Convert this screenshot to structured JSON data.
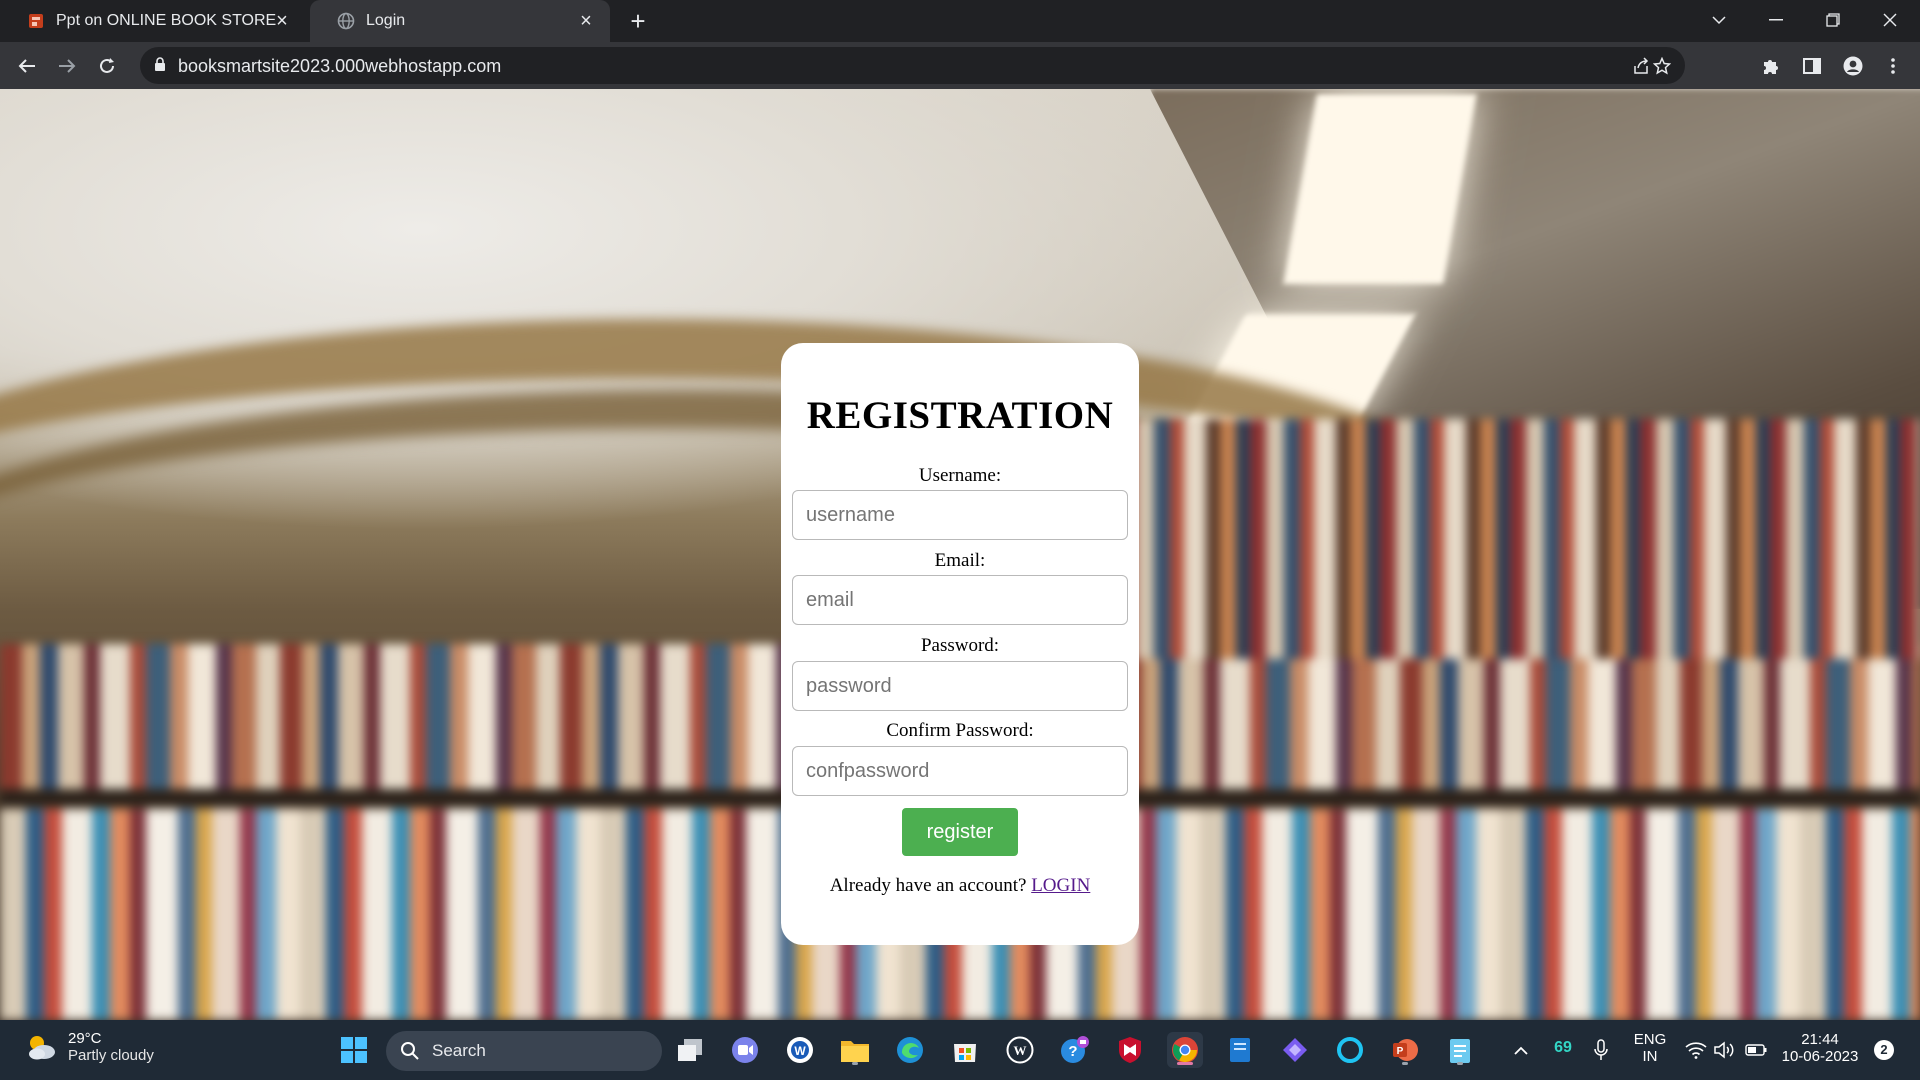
{
  "browser": {
    "tabs": [
      {
        "title": "Ppt on ONLINE BOOK STORE",
        "active": false,
        "icon": "powerpoint-favicon"
      },
      {
        "title": "Login",
        "active": true,
        "icon": "globe-favicon"
      }
    ],
    "url": "booksmartsite2023.000webhostapp.com"
  },
  "page": {
    "heading": "REGISTRATION",
    "fields": [
      {
        "label": "Username:",
        "placeholder": "username"
      },
      {
        "label": "Email:",
        "placeholder": "email"
      },
      {
        "label": "Password:",
        "placeholder": "password"
      },
      {
        "label": "Confirm Password:",
        "placeholder": "confpassword"
      }
    ],
    "register_label": "register",
    "login_prompt": "Already have an account?",
    "login_link": "LOGIN",
    "accent_color": "#4caf50",
    "link_color": "#551a8b"
  },
  "taskbar": {
    "weather": {
      "temp": "29°C",
      "condition": "Partly cloudy"
    },
    "search_label": "Search",
    "tray": {
      "badge_number": "69",
      "language": "ENG",
      "region": "IN",
      "time": "21:44",
      "date": "10-06-2023",
      "notifications": "2"
    }
  }
}
